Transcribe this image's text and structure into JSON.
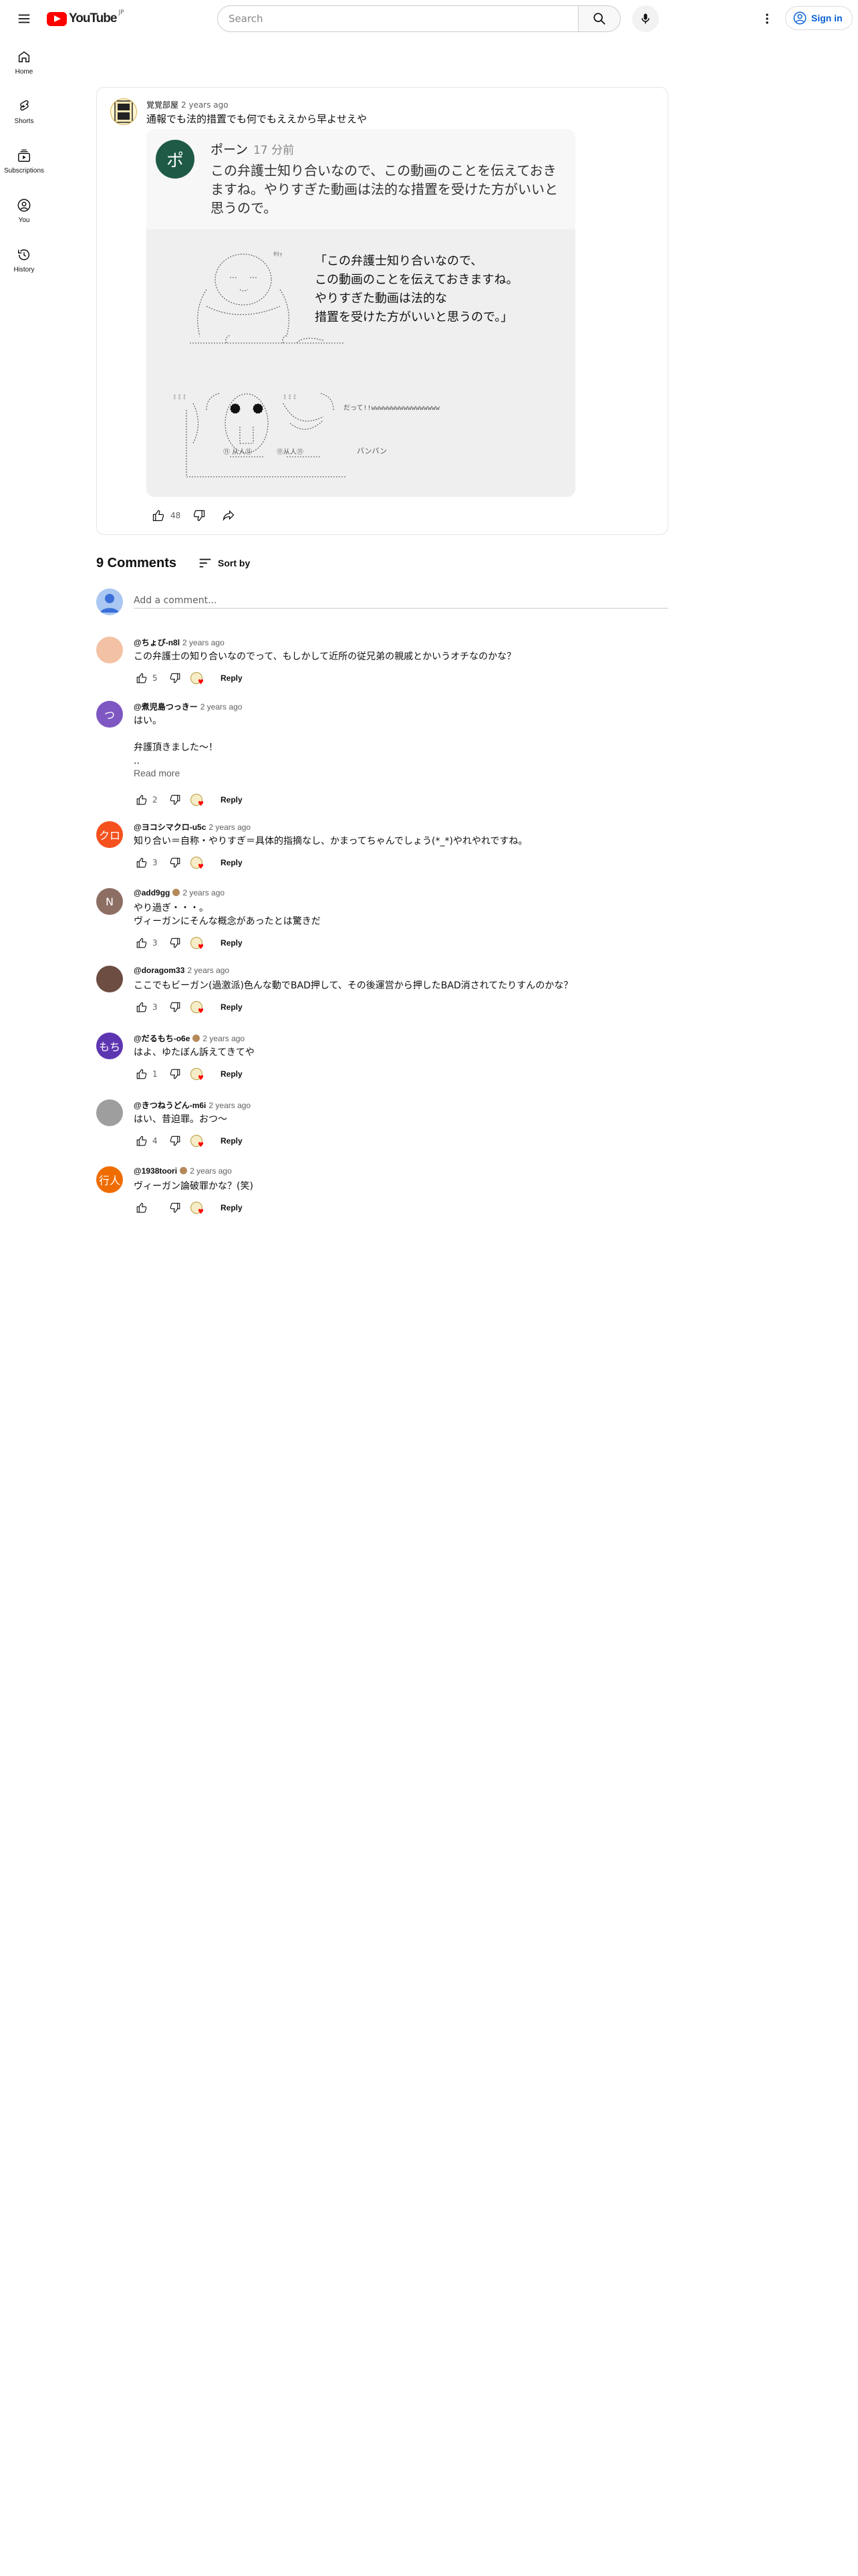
{
  "header": {
    "logo_text": "YouTube",
    "logo_country": "JP",
    "search_placeholder": "Search",
    "signin_label": "Sign in",
    "icons": [
      "menu-icon",
      "search-icon",
      "mic-icon",
      "more-vert-icon",
      "account-circle-icon"
    ]
  },
  "guide": {
    "items": [
      {
        "label": "Home",
        "icon": "home-icon"
      },
      {
        "label": "Shorts",
        "icon": "shorts-icon"
      },
      {
        "label": "Subscriptions",
        "icon": "subscriptions-icon"
      },
      {
        "label": "You",
        "icon": "you-icon"
      },
      {
        "label": "History",
        "icon": "history-icon"
      }
    ]
  },
  "post": {
    "author": "覚覚部屋",
    "time": "2 years ago",
    "text": "通報でも法的措置でも何でもええから早よせえや",
    "likes": "48",
    "image": {
      "tweet_avatar_char": "ポ",
      "tweet_name": "ポーン",
      "tweet_age": "17 分前",
      "tweet_body": "この弁護士知り合いなので、この動画のことを伝えておきますね。やりすぎた動画は法的な措置を受けた方がいいと思うので。",
      "aa_quote": "「この弁護士知り合いなので、\nこの動画のことを伝えておきますね。\nやりすぎた動画は法的な\n措置を受けた方がいいと思うので。」",
      "aa_laugh": "だって!!wwwwwwwwwwwwwwwww",
      "aa_bang": "バンバン"
    }
  },
  "comments_section": {
    "count_label": "9 Comments",
    "sort_label": "Sort by",
    "add_placeholder": "Add a comment...",
    "reply_label": "Reply",
    "read_more_label": "Read more"
  },
  "comments": [
    {
      "author": "@ちょび-n8l",
      "time": "2 years ago",
      "text": "この弁護士の知り合いなのでって、もしかして近所の従兄弟の親戚とかいうオチなのかな？",
      "likes": "5",
      "avatar_char": "",
      "avatar_color": "#f3c1a4"
    },
    {
      "author": "@煮児島つっきー",
      "time": "2 years ago",
      "text": "はい。\n\n弁護頂きました〜！\n..",
      "likes": "2",
      "avatar_char": "つ",
      "avatar_color": "#7e57c2"
    },
    {
      "author": "@ヨコシマクロ-u5c",
      "time": "2 years ago",
      "text": "知り合い＝自称・やりすぎ＝具体的指摘なし、かまってちゃんでしょう(*_*)やれやれですね。",
      "likes": "3",
      "avatar_char": "クロ",
      "avatar_color": "#f4511e"
    },
    {
      "author": "@add9gg",
      "time": "2 years ago",
      "text": "やり過ぎ・・・。\nヴィーガンにそんな概念があったとは驚きだ",
      "likes": "3",
      "avatar_char": "N",
      "avatar_color": "#8d6e63"
    },
    {
      "author": "@doragom33",
      "time": "2 years ago",
      "text": "ここでもビーガン(過激派)色んな動でBAD押して、その後運営から押したBAD消されてたりすんのかな？",
      "likes": "3",
      "avatar_char": "",
      "avatar_color": "#6d4c41"
    },
    {
      "author": "@だるもち-o6e",
      "time": "2 years ago",
      "text": "はよ、ゆたぼん訴えてきてや",
      "likes": "1",
      "avatar_char": "もち",
      "avatar_color": "#5e35b1"
    },
    {
      "author": "@きつねうどん-m6i",
      "time": "2 years ago",
      "text": "はい、昔迫罪。おつ〜",
      "likes": "4",
      "avatar_char": "",
      "avatar_color": "#9e9e9e"
    },
    {
      "author": "@1938toori",
      "time": "2 years ago",
      "text": "ヴィーガン論破罪かな？(笑)",
      "likes": "",
      "avatar_char": "行人",
      "avatar_color": "#ef6c00"
    }
  ],
  "colors": {
    "brand_red": "#ff0000",
    "link_blue": "#065fd4",
    "secondary_text": "#606060"
  }
}
